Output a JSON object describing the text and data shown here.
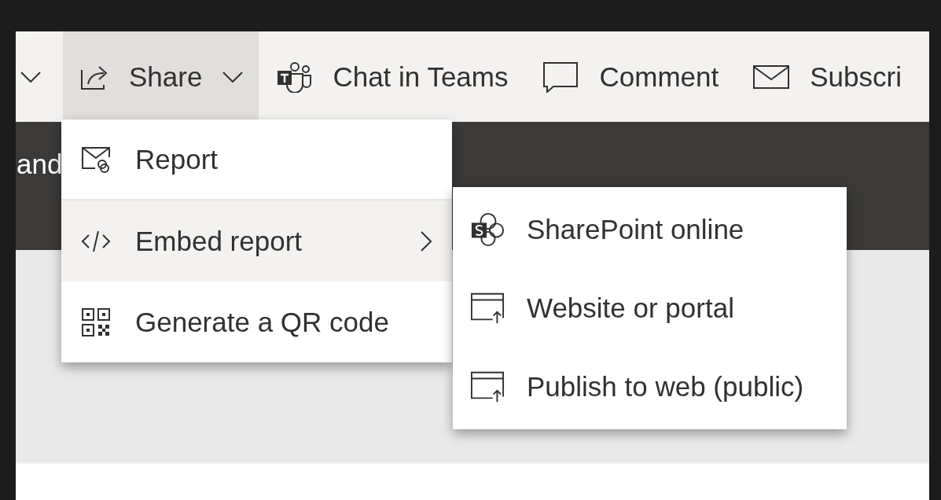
{
  "toolbar": {
    "items": [
      {
        "label": "Share",
        "kind": "share",
        "selected": true,
        "has_dropdown": true
      },
      {
        "label": "Chat in Teams",
        "kind": "teams",
        "selected": false,
        "has_dropdown": false
      },
      {
        "label": "Comment",
        "kind": "comment",
        "selected": false,
        "has_dropdown": false
      },
      {
        "label": "Subscri",
        "kind": "mail",
        "selected": false,
        "has_dropdown": false
      }
    ]
  },
  "banner": {
    "text": "and"
  },
  "share_menu": {
    "items": [
      {
        "label": "Report",
        "kind": "report",
        "selected": false,
        "has_submenu": false
      },
      {
        "label": "Embed report",
        "kind": "embed",
        "selected": true,
        "has_submenu": true
      },
      {
        "label": "Generate a QR code",
        "kind": "qr",
        "selected": false,
        "has_submenu": false
      }
    ]
  },
  "embed_submenu": {
    "items": [
      {
        "label": "SharePoint online",
        "kind": "sharepoint",
        "selected": false
      },
      {
        "label": "Website or portal",
        "kind": "window",
        "selected": false
      },
      {
        "label": "Publish to web (public)",
        "kind": "window",
        "selected": false
      }
    ]
  }
}
